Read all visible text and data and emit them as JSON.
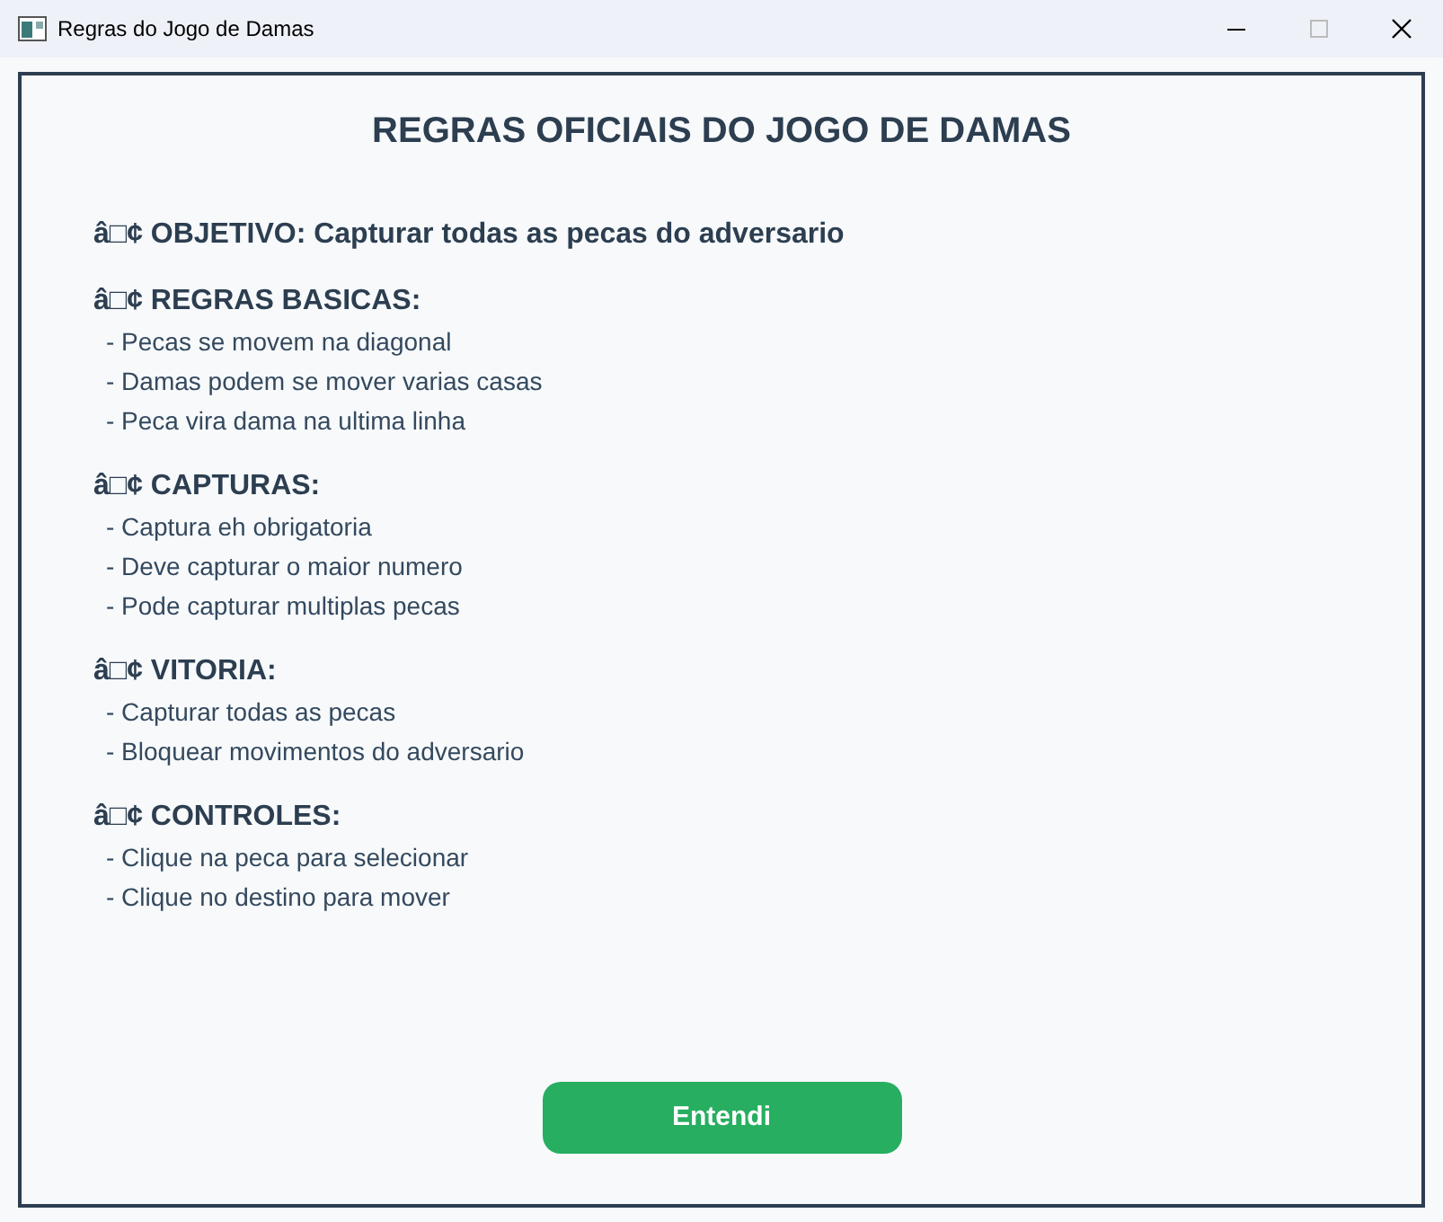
{
  "window": {
    "title": "Regras do Jogo de Damas"
  },
  "heading": "REGRAS OFICIAIS DO JOGO DE DAMAS",
  "sections": [
    {
      "heading": "â□¢ OBJETIVO: Capturar todas as pecas do adversario"
    },
    {
      "heading": "â□¢ REGRAS BASICAS:",
      "items": [
        "- Pecas se movem na diagonal",
        "- Damas podem se mover varias casas",
        "- Peca vira dama na ultima linha"
      ]
    },
    {
      "heading": "â□¢ CAPTURAS:",
      "items": [
        "- Captura eh obrigatoria",
        "- Deve capturar o maior numero",
        "- Pode capturar multiplas pecas"
      ]
    },
    {
      "heading": "â□¢ VITORIA:",
      "items": [
        "- Capturar todas as pecas",
        "- Bloquear movimentos do adversario"
      ]
    },
    {
      "heading": "â□¢ CONTROLES:",
      "items": [
        "- Clique na peca para selecionar",
        "- Clique no destino para mover"
      ]
    }
  ],
  "button": "Entendi"
}
